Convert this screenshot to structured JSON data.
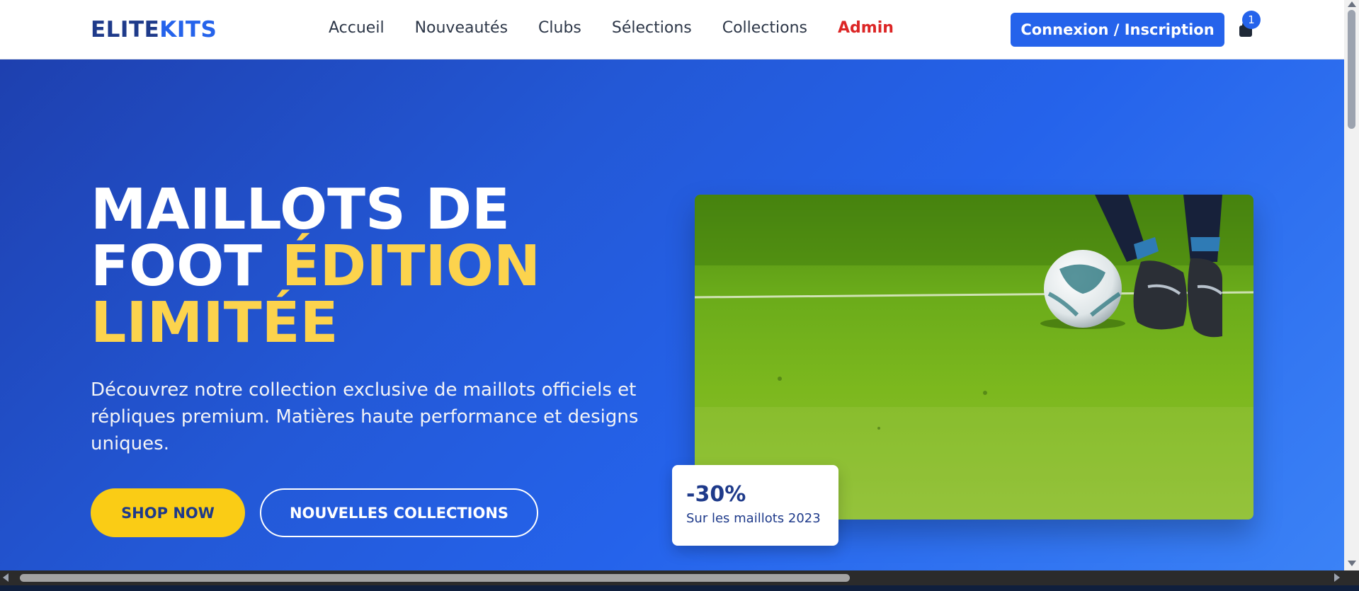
{
  "header": {
    "logo_part1": "ELITE",
    "logo_part2": "KITS",
    "nav": [
      "Accueil",
      "Nouveautés",
      "Clubs",
      "Sélections",
      "Collections",
      "Admin"
    ],
    "login_label": "Connexion / Inscription",
    "cart_icon": "shopping-bag-icon",
    "cart_count": "1"
  },
  "hero": {
    "title_line1": "MAILLOTS DE",
    "title_line2_white": "FOOT ",
    "title_line2_yellow": "ÉDITION",
    "title_line3": "LIMITÉE",
    "subtitle": "Découvrez notre collection exclusive de maillots officiels et répliques premium. Matières haute performance et designs uniques.",
    "btn_primary": "SHOP NOW",
    "btn_secondary": "NOUVELLES COLLECTIONS",
    "promo_value": "-30%",
    "promo_text": "Sur les maillots 2023"
  },
  "colors": {
    "brand_dark": "#1e3a8a",
    "brand": "#2563eb",
    "accent_yellow": "#facc15",
    "admin_red": "#dc2626"
  }
}
